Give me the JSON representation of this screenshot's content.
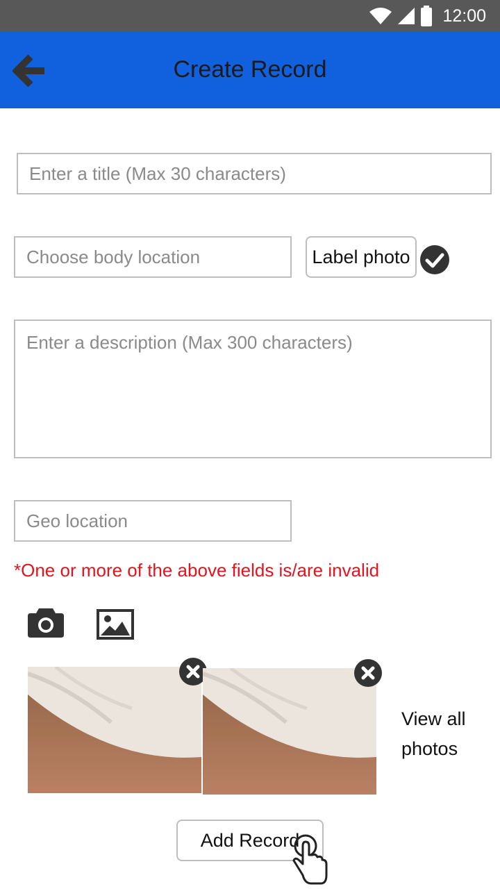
{
  "status_bar": {
    "time": "12:00",
    "icons": [
      "wifi-icon",
      "signal-icon",
      "battery-icon"
    ]
  },
  "app_bar": {
    "title": "Create Record",
    "back_icon": "arrow-left-icon",
    "background": "#1160dd"
  },
  "form": {
    "title_placeholder": "Enter a title (Max 30 characters)",
    "body_location_placeholder": "Choose body location",
    "label_photo_button": "Label photo",
    "label_photo_status_icon": "check-circle-icon",
    "description_placeholder": "Enter a description (Max 300 characters)",
    "geo_location_placeholder": "Geo location",
    "error_message": "*One or more of the above fields is/are invalid",
    "error_color": "#e3141e"
  },
  "media": {
    "camera_icon": "camera-icon",
    "gallery_icon": "image-icon",
    "photos": [
      {
        "remove_icon": "close-circle-icon"
      },
      {
        "remove_icon": "close-circle-icon"
      }
    ],
    "view_all_label": "View all photos"
  },
  "actions": {
    "add_record_label": "Add Record",
    "pointer_icon": "hand-pointer-icon"
  }
}
